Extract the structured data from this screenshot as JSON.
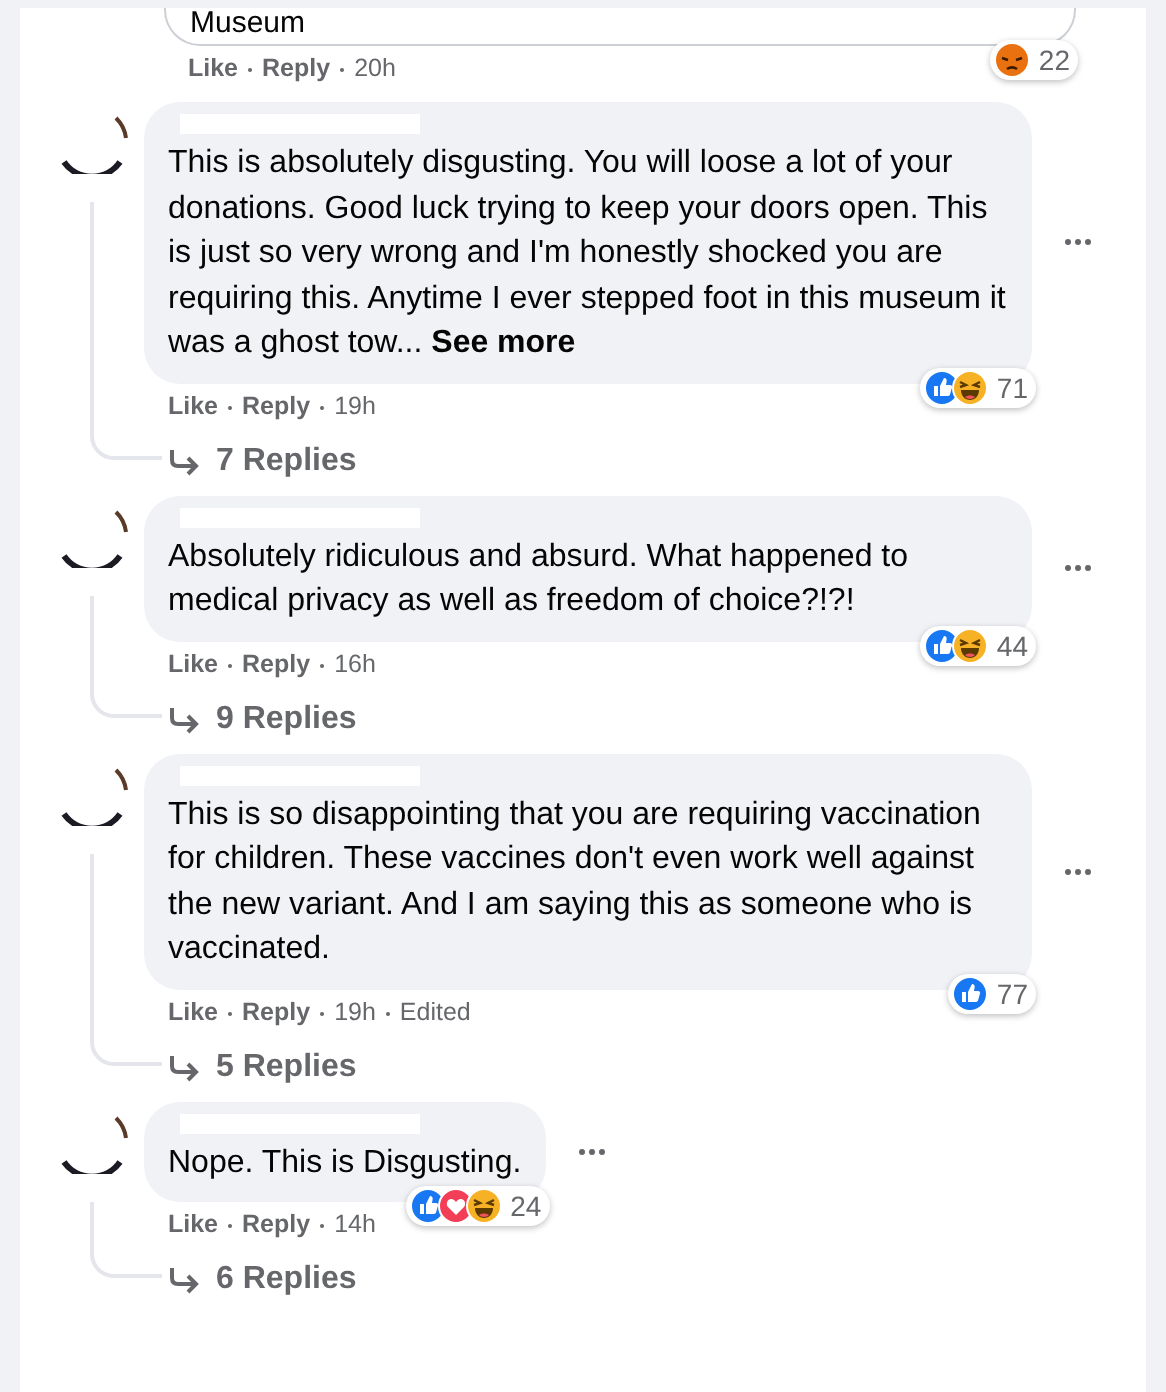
{
  "previous_comment": {
    "text": "Museum",
    "like": "Like",
    "reply": "Reply",
    "time": "20h",
    "reactions": [
      {
        "kind": "angry"
      }
    ],
    "reaction_count": "22"
  },
  "comments": [
    {
      "text": "This is absolutely disgusting. You will loose a lot of your donations. Good luck trying to keep your doors open. This is just so very wrong and I'm honestly shocked you are requiring this. Anytime I ever stepped foot in this museum it was a ghost tow...",
      "see_more": "See more",
      "like": "Like",
      "reply": "Reply",
      "time": "19h",
      "reactions": [
        {
          "kind": "like"
        },
        {
          "kind": "haha"
        }
      ],
      "reaction_count": "71",
      "replies": "7 Replies"
    },
    {
      "text": "Absolutely ridiculous and absurd. What happened to medical privacy as well as freedom of choice?!?!",
      "like": "Like",
      "reply": "Reply",
      "time": "16h",
      "reactions": [
        {
          "kind": "like"
        },
        {
          "kind": "haha"
        }
      ],
      "reaction_count": "44",
      "replies": "9 Replies"
    },
    {
      "text": "This is so disappointing that you are requiring vaccination for children. These vaccines don't even work well against the new variant. And I am saying this as someone who is vaccinated.",
      "like": "Like",
      "reply": "Reply",
      "time": "19h",
      "edited": "Edited",
      "reactions": [
        {
          "kind": "like"
        }
      ],
      "reaction_count": "77",
      "replies": "5 Replies"
    },
    {
      "text": "Nope. This is Disgusting.",
      "like": "Like",
      "reply": "Reply",
      "time": "14h",
      "reactions": [
        {
          "kind": "like"
        },
        {
          "kind": "love"
        },
        {
          "kind": "haha"
        }
      ],
      "reaction_count": "24",
      "replies": "6 Replies"
    }
  ]
}
